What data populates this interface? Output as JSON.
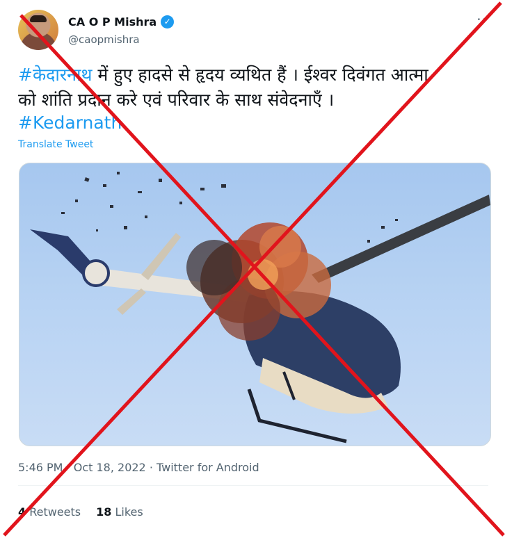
{
  "author": {
    "name": "CA O P Mishra",
    "handle": "@caopmishra",
    "verified_icon": "verified-badge-icon"
  },
  "tweet": {
    "hashtag_kedarnath_hi": "#केदारनाथ",
    "text_line1_rest": " में हुए हादसे से हृदय व्यथित हैं । ईश्वर दिवंगत आत्मा",
    "text_line2": "को शांति प्रदान करे एवं परिवार के साथ संवेदनाएँ ।",
    "hashtag_kedarnath_en": "#Kedarnath",
    "translate_label": "Translate Tweet"
  },
  "meta": {
    "timestamp": "5:46 PM · Oct 18, 2022 · Twitter for Android"
  },
  "stats": {
    "retweets_count": "4",
    "retweets_label": "Retweets",
    "likes_count": "18",
    "likes_label": "Likes"
  },
  "colors": {
    "accent": "#1d9bf0",
    "cross": "#e1141c"
  }
}
